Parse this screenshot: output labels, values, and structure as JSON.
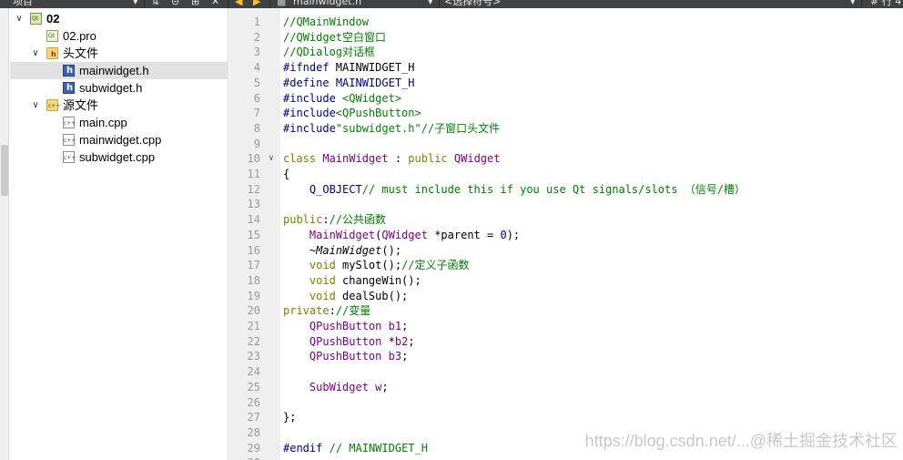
{
  "toolbar": {
    "panel_title": "项目",
    "file_tab": "mainwidget.h",
    "symbol_selector": "<选择符号>",
    "position": "# 行 4"
  },
  "project_tree": [
    {
      "label": "02",
      "level": 0,
      "icon": "qt-project-icon",
      "expanded": true,
      "bold": true,
      "selected": false
    },
    {
      "label": "02.pro",
      "level": 1,
      "icon": "qt-pro-file-icon",
      "expanded": null,
      "bold": false,
      "selected": false
    },
    {
      "label": "头文件",
      "level": 1,
      "icon": "header-folder-icon",
      "expanded": true,
      "bold": false,
      "selected": false
    },
    {
      "label": "mainwidget.h",
      "level": 2,
      "icon": "header-file-icon",
      "expanded": null,
      "bold": false,
      "selected": true
    },
    {
      "label": "subwidget.h",
      "level": 2,
      "icon": "header-file-icon",
      "expanded": null,
      "bold": false,
      "selected": false
    },
    {
      "label": "源文件",
      "level": 1,
      "icon": "source-folder-icon",
      "expanded": true,
      "bold": false,
      "selected": false
    },
    {
      "label": "main.cpp",
      "level": 2,
      "icon": "cpp-file-icon",
      "expanded": null,
      "bold": false,
      "selected": false
    },
    {
      "label": "mainwidget.cpp",
      "level": 2,
      "icon": "cpp-file-icon",
      "expanded": null,
      "bold": false,
      "selected": false
    },
    {
      "label": "subwidget.cpp",
      "level": 2,
      "icon": "cpp-file-icon",
      "expanded": null,
      "bold": false,
      "selected": false
    }
  ],
  "code_lines": [
    {
      "n": "1",
      "fold": "",
      "tokens": [
        [
          "cm",
          "//QMainWindow"
        ]
      ]
    },
    {
      "n": "2",
      "fold": "",
      "tokens": [
        [
          "cm",
          "//QWidget空白窗口"
        ]
      ]
    },
    {
      "n": "3",
      "fold": "",
      "tokens": [
        [
          "cm",
          "//QDialog对话框"
        ]
      ]
    },
    {
      "n": "4",
      "fold": "",
      "tokens": [
        [
          "pp",
          "#ifndef"
        ],
        [
          "plain",
          " MAINWIDGET_H"
        ]
      ]
    },
    {
      "n": "5",
      "fold": "",
      "tokens": [
        [
          "pp",
          "#define"
        ],
        [
          "plain",
          " "
        ],
        [
          "pp",
          "MAINWIDGET_H"
        ]
      ]
    },
    {
      "n": "6",
      "fold": "",
      "tokens": [
        [
          "pp",
          "#include"
        ],
        [
          "plain",
          " "
        ],
        [
          "str",
          "<QWidget>"
        ]
      ]
    },
    {
      "n": "7",
      "fold": "",
      "tokens": [
        [
          "pp",
          "#include"
        ],
        [
          "str",
          "<QPushButton>"
        ]
      ]
    },
    {
      "n": "8",
      "fold": "",
      "tokens": [
        [
          "pp",
          "#include"
        ],
        [
          "str",
          "\"subwidget.h\""
        ],
        [
          "cm",
          "//子窗口头文件"
        ]
      ]
    },
    {
      "n": "9",
      "fold": "",
      "tokens": []
    },
    {
      "n": "10",
      "fold": "∨",
      "tokens": [
        [
          "kw",
          "class"
        ],
        [
          "plain",
          " "
        ],
        [
          "type",
          "MainWidget"
        ],
        [
          "plain",
          " : "
        ],
        [
          "kw",
          "public"
        ],
        [
          "plain",
          " "
        ],
        [
          "type",
          "QWidget"
        ]
      ]
    },
    {
      "n": "11",
      "fold": "",
      "tokens": [
        [
          "plain",
          "{"
        ]
      ]
    },
    {
      "n": "12",
      "fold": "",
      "tokens": [
        [
          "plain",
          "    "
        ],
        [
          "pp",
          "Q_OBJECT"
        ],
        [
          "cm",
          "// must include this if you use Qt signals/slots （信号/槽）"
        ]
      ]
    },
    {
      "n": "13",
      "fold": "",
      "tokens": []
    },
    {
      "n": "14",
      "fold": "",
      "tokens": [
        [
          "kw",
          "public"
        ],
        [
          "plain",
          ":"
        ],
        [
          "cm",
          "//公共函数"
        ]
      ]
    },
    {
      "n": "15",
      "fold": "",
      "tokens": [
        [
          "plain",
          "    "
        ],
        [
          "type",
          "MainWidget"
        ],
        [
          "plain",
          "("
        ],
        [
          "type",
          "QWidget"
        ],
        [
          "plain",
          " *parent = "
        ],
        [
          "pp",
          "0"
        ],
        [
          "plain",
          ");"
        ]
      ]
    },
    {
      "n": "16",
      "fold": "",
      "tokens": [
        [
          "plain",
          "    ~"
        ],
        [
          "ital",
          "MainWidget"
        ],
        [
          "plain",
          "();"
        ]
      ]
    },
    {
      "n": "17",
      "fold": "",
      "tokens": [
        [
          "plain",
          "    "
        ],
        [
          "kw",
          "void"
        ],
        [
          "plain",
          " mySlot();"
        ],
        [
          "cm",
          "//定义子函数"
        ]
      ]
    },
    {
      "n": "18",
      "fold": "",
      "tokens": [
        [
          "plain",
          "    "
        ],
        [
          "kw",
          "void"
        ],
        [
          "plain",
          " changeWin();"
        ]
      ]
    },
    {
      "n": "19",
      "fold": "",
      "tokens": [
        [
          "plain",
          "    "
        ],
        [
          "kw",
          "void"
        ],
        [
          "plain",
          " dealSub();"
        ]
      ]
    },
    {
      "n": "20",
      "fold": "",
      "tokens": [
        [
          "kw",
          "private"
        ],
        [
          "plain",
          ":"
        ],
        [
          "cm",
          "//变量"
        ]
      ]
    },
    {
      "n": "21",
      "fold": "",
      "tokens": [
        [
          "plain",
          "    "
        ],
        [
          "type",
          "QPushButton"
        ],
        [
          "plain",
          " "
        ],
        [
          "type",
          "b1"
        ],
        [
          "plain",
          ";"
        ]
      ]
    },
    {
      "n": "22",
      "fold": "",
      "tokens": [
        [
          "plain",
          "    "
        ],
        [
          "type",
          "QPushButton"
        ],
        [
          "plain",
          " *"
        ],
        [
          "type",
          "b2"
        ],
        [
          "plain",
          ";"
        ]
      ]
    },
    {
      "n": "23",
      "fold": "",
      "tokens": [
        [
          "plain",
          "    "
        ],
        [
          "type",
          "QPushButton"
        ],
        [
          "plain",
          " "
        ],
        [
          "type",
          "b3"
        ],
        [
          "plain",
          ";"
        ]
      ]
    },
    {
      "n": "24",
      "fold": "",
      "tokens": []
    },
    {
      "n": "25",
      "fold": "",
      "tokens": [
        [
          "plain",
          "    "
        ],
        [
          "type",
          "SubWidget"
        ],
        [
          "plain",
          " "
        ],
        [
          "type",
          "w"
        ],
        [
          "plain",
          ";"
        ]
      ]
    },
    {
      "n": "26",
      "fold": "",
      "tokens": []
    },
    {
      "n": "27",
      "fold": "",
      "tokens": [
        [
          "plain",
          "};"
        ]
      ]
    },
    {
      "n": "28",
      "fold": "",
      "tokens": []
    },
    {
      "n": "29",
      "fold": "",
      "tokens": [
        [
          "pp",
          "#endif"
        ],
        [
          "plain",
          " "
        ],
        [
          "cm",
          "// MAINWIDGET_H"
        ]
      ]
    },
    {
      "n": "30",
      "fold": "",
      "tokens": []
    }
  ],
  "watermark": "https://blog.csdn.net/...@稀土掘金技术社区",
  "colors": {
    "keyword": "#808000",
    "type": "#800080",
    "string": "#008000",
    "comment": "#008000",
    "preprocessor": "#000080",
    "gutter": "#efefef",
    "selection": "#e1e1e1"
  }
}
